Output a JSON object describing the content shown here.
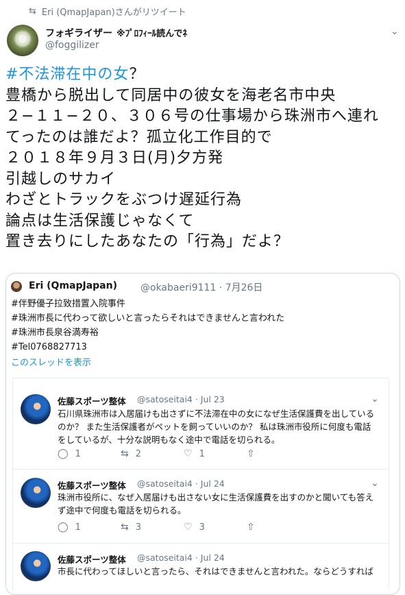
{
  "retweet": {
    "icon": "retweet-icon",
    "text": "Eri (QmapJapan)さんがリツイート"
  },
  "tweet": {
    "author_name": "フォギライザー",
    "author_note": "※ﾌﾟﾛﾌｨｰﾙ読んでﾈ",
    "handle": "@foggilizer",
    "hashtag": "#不法滞在中の女",
    "lines": [
      "？",
      "豊橋から脱出して同居中の彼女を海老名市中央",
      "２−１１−２０、３０６号の仕事場から珠洲市へ連れ",
      "てったのは誰だよ？孤立化工作目的で",
      "２０１８年９月３日(月)夕方発",
      "引越しのサカイ",
      "わざとトラックをぶつけ遅延行為",
      "論点は生活保護じゃなくて",
      "置き去りにしたあなたの「行為」だよ？"
    ]
  },
  "quote": {
    "name": "Eri (QmapJapan)",
    "handle_date": "@okabaeri9111 · 7月26日",
    "lines": [
      "#伴野優子拉致措置入院事件",
      "#珠洲市長に代わって欲しいと言ったらそれはできませんと言われた",
      "#珠洲市長泉谷満寿裕",
      "#Tel0768827713"
    ],
    "thread_link": "このスレッドを表示"
  },
  "embedded": [
    {
      "name": "佐藤スポーツ整体",
      "handle_date": "@satoseitai4 · Jul 23",
      "lines": [
        "石川県珠洲市は入居届けも出さずに不法滞在中の女になぜ生活保護費を出している",
        "のか？ また生活保護者がペットを飼っていいのか？ 私は珠洲市役所に何度も電話",
        "をしているが、十分な説明もなく途中で電話を切られる。"
      ],
      "replies": "1",
      "retweets": "2",
      "likes": "1"
    },
    {
      "name": "佐藤スポーツ整体",
      "handle_date": "@satoseitai4 · Jul 24",
      "lines": [
        "珠洲市役所に、なぜ入居届けも出さない女に生活保護費を出すのかと聞いても答え",
        "ず途中で何度も電話を切られる。"
      ],
      "replies": "1",
      "retweets": "3",
      "likes": "3"
    },
    {
      "name": "佐藤スポーツ整体",
      "handle_date": "@satoseitai4 · Jul 24",
      "lines": [
        "市長に代わってほしいと言ったら、それはできませんと言われた。ならどうすれば"
      ]
    }
  ],
  "colors": {
    "link": "#1b95e0",
    "muted": "#657786",
    "text": "#14171a",
    "border": "#ccd6dd"
  }
}
